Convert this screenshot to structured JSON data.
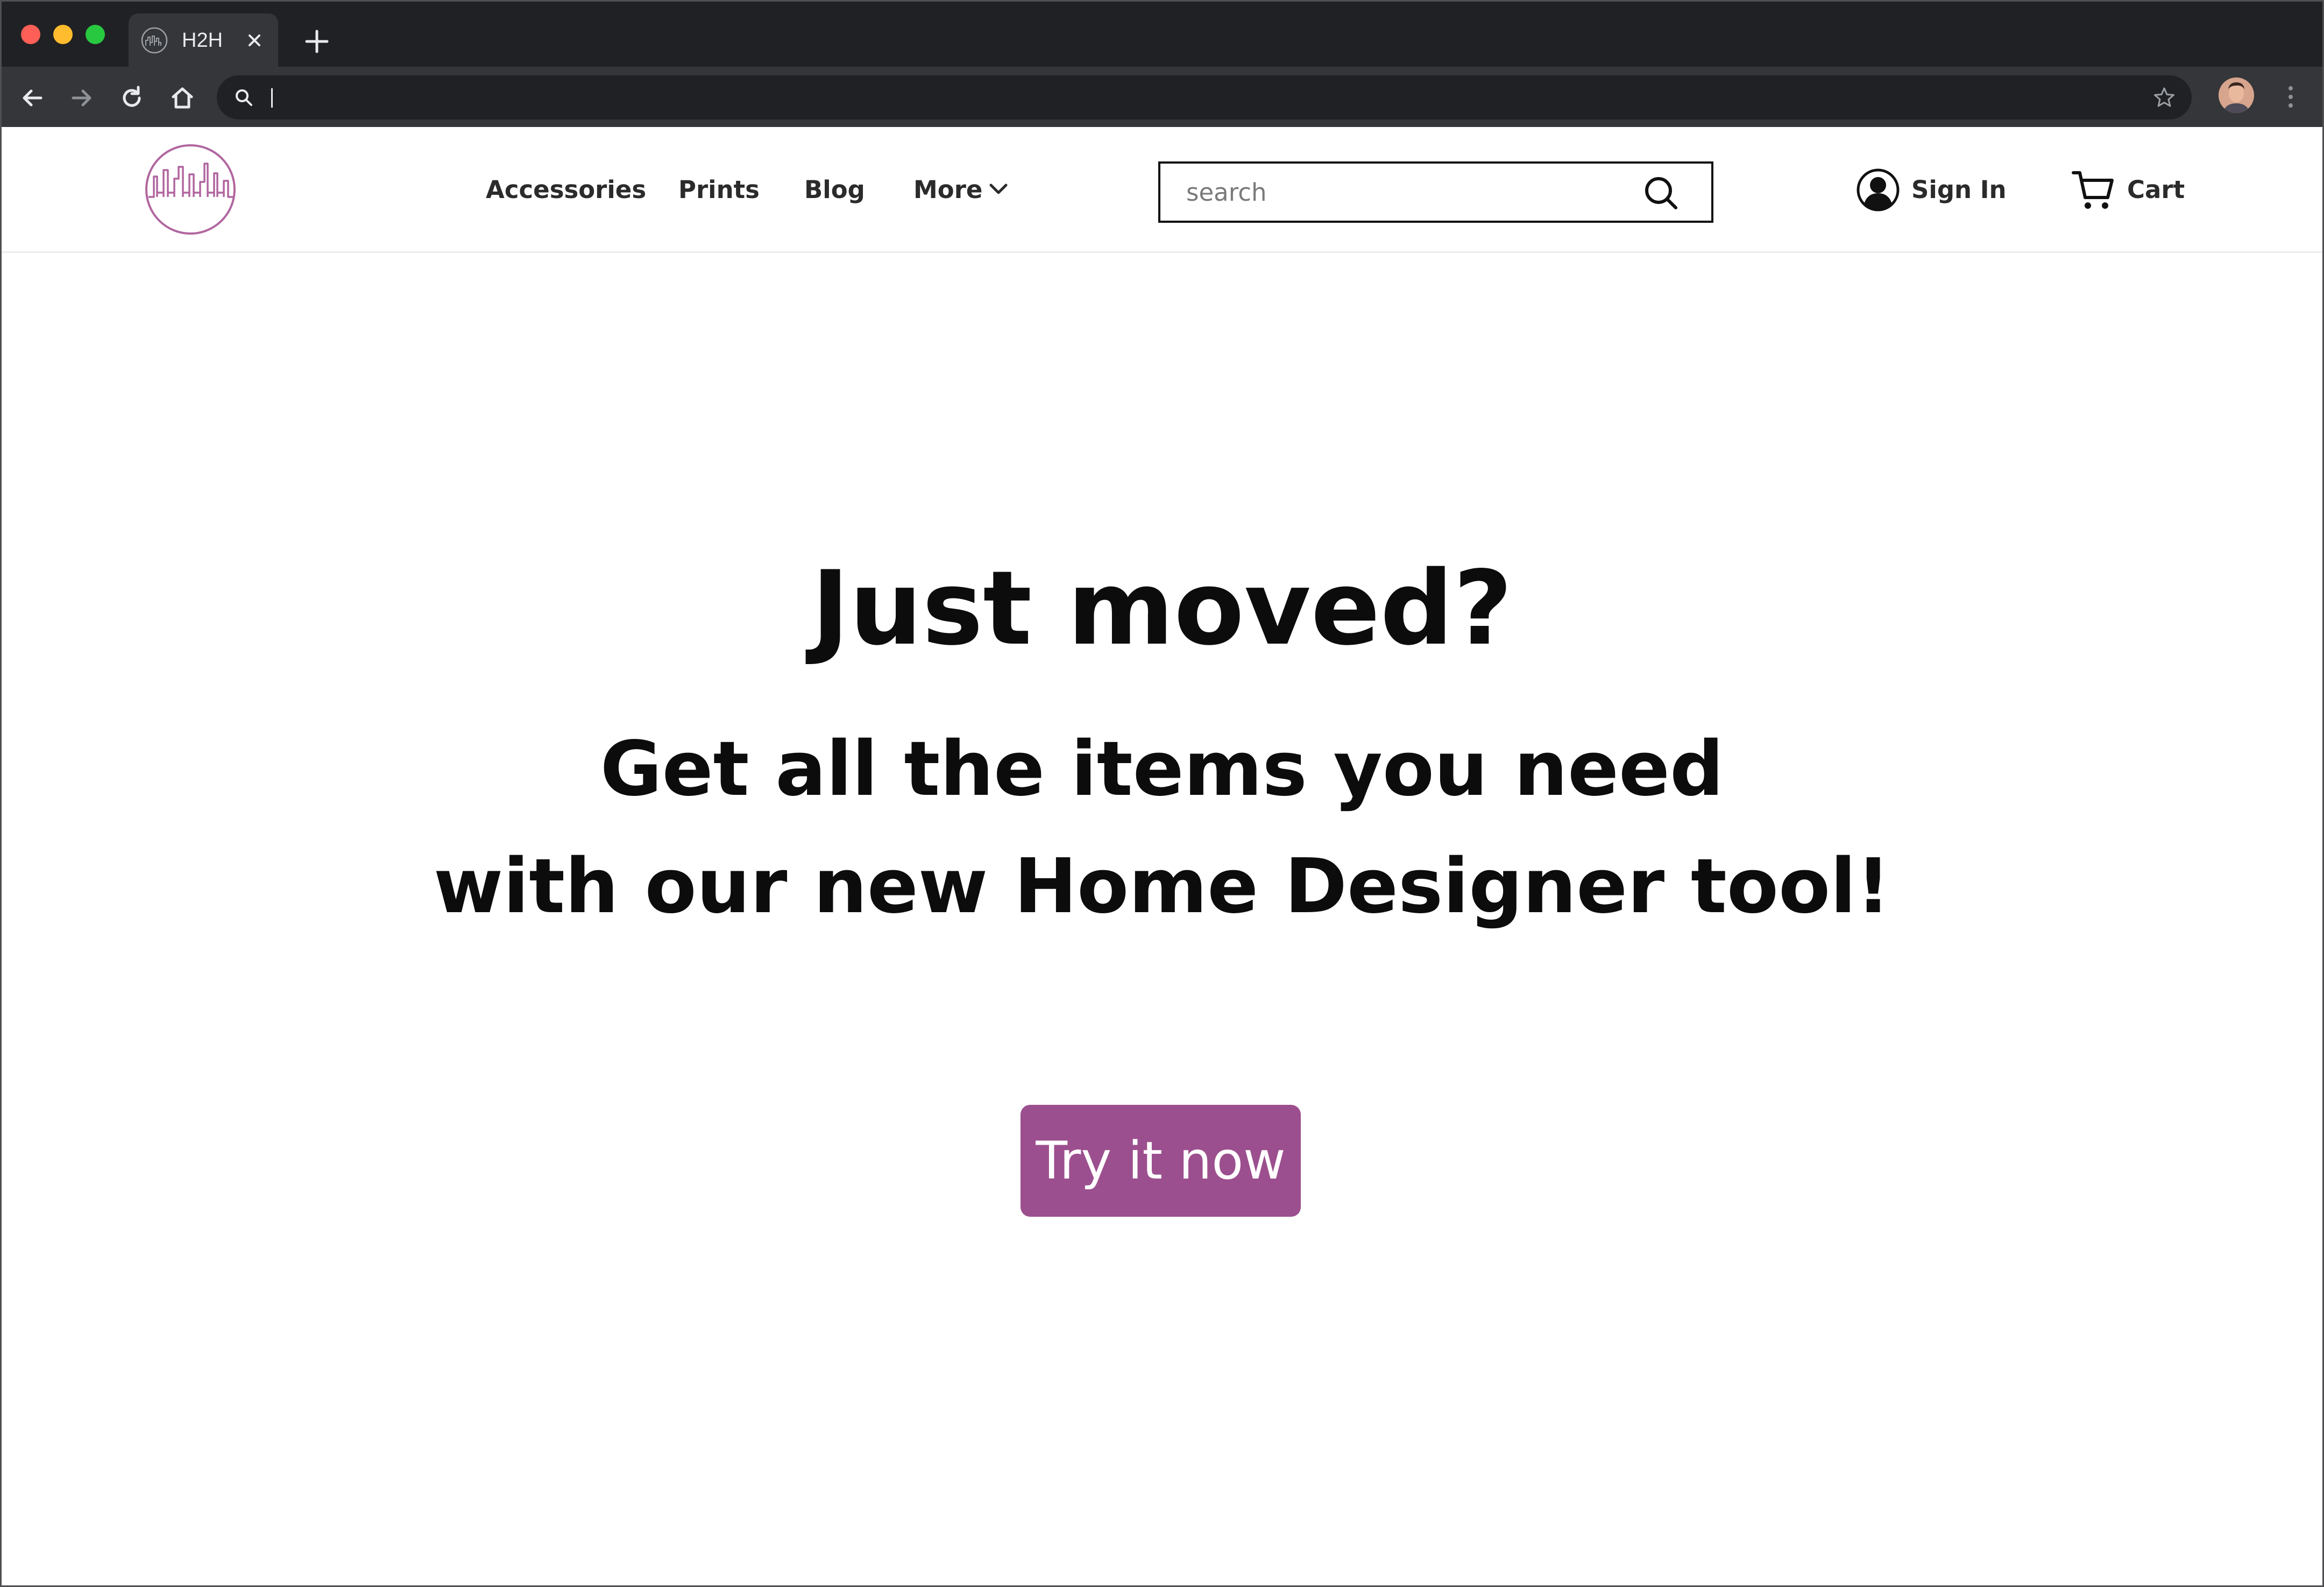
{
  "browser": {
    "tab": {
      "title": "H2H",
      "favicon": "h2h-logo-icon"
    },
    "omnibox": {
      "value": "",
      "placeholder": ""
    },
    "colors": {
      "chrome_dark": "#202124",
      "chrome_mid": "#35363a",
      "traffic_red": "#ff5f57",
      "traffic_yellow": "#febc2e",
      "traffic_green": "#28c840"
    }
  },
  "header": {
    "logo": "skyline-logo-icon",
    "nav": {
      "accessories": "Accessories",
      "prints": "Prints",
      "blog": "Blog",
      "more": "More"
    },
    "search": {
      "placeholder": "search",
      "value": ""
    },
    "signin_label": "Sign In",
    "cart_label": "Cart"
  },
  "hero": {
    "title": "Just moved?",
    "subtitle_line1": "Get all the items you need",
    "subtitle_line2": "with our new Home Designer tool!",
    "cta_label": "Try it now"
  },
  "theme": {
    "brand": "#9c4f8e",
    "logo_stroke": "#b1669f",
    "text": "#0c0c0c"
  }
}
